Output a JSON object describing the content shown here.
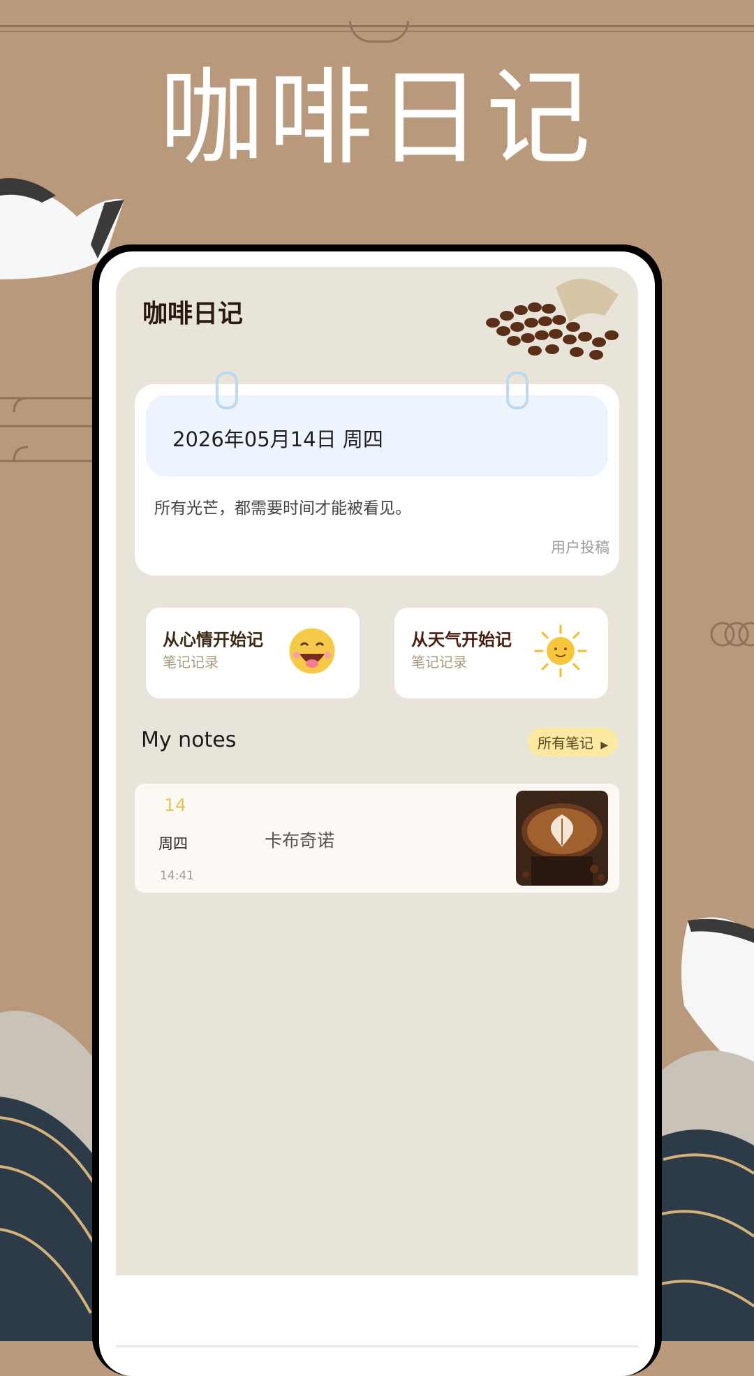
{
  "promo": {
    "title": "咖啡日记"
  },
  "app": {
    "title": "咖啡日记",
    "daily_card": {
      "date": "2026年05月14日 周四",
      "quote": "所有光芒，都需要时间才能被看见。",
      "source": "用户投稿"
    },
    "quick_entries": [
      {
        "title": "从心情开始记",
        "subtitle": "笔记记录",
        "icon": "smiling-face-icon",
        "title_color": "#3b2a14"
      },
      {
        "title": "从天气开始记",
        "subtitle": "笔记记录",
        "icon": "sun-icon",
        "title_color": "#4a1d10"
      }
    ],
    "notes": {
      "heading": "My notes",
      "all_label": "所有笔记",
      "items": [
        {
          "day": "14",
          "weekday": "周四",
          "time": "14:41",
          "name": "卡布奇诺",
          "image": "latte-art-cup-image"
        }
      ]
    }
  },
  "colors": {
    "background": "#b8997b",
    "app_background": "#e8e4da",
    "date_bar": "#eef4fd",
    "accent_yellow": "#e8c35a",
    "all_notes_pill": "#fbe9a2"
  }
}
